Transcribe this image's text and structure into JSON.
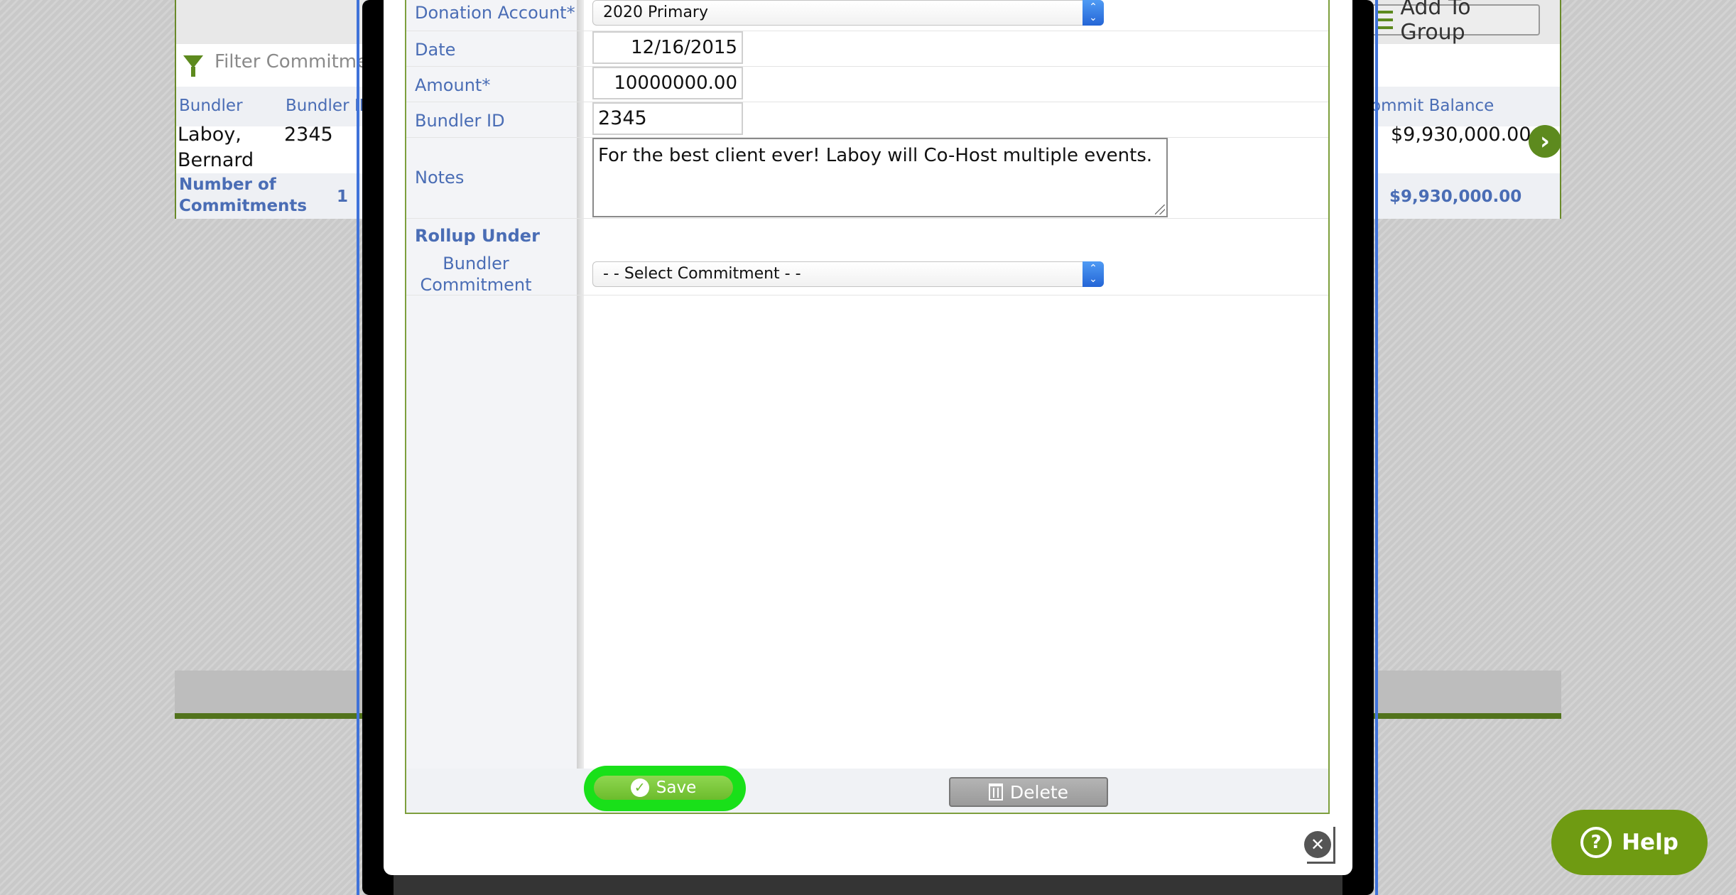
{
  "background": {
    "add_to_group_label": "Add To Group",
    "filter_placeholder": "Filter Commitme",
    "columns": [
      "Bundler",
      "Bundler ID",
      "ommit Balance"
    ],
    "row": {
      "bundler": "Laboy, Bernard",
      "bundler_id": "2345",
      "commit_balance": "$9,930,000.00"
    },
    "footer": {
      "label": "Number of Commitments",
      "count": "1",
      "total": "$9,930,000.00"
    }
  },
  "form": {
    "donation_account": {
      "label": "Donation Account*",
      "value": "2020 Primary"
    },
    "date": {
      "label": "Date",
      "value": "12/16/2015"
    },
    "amount": {
      "label": "Amount*",
      "value": "10000000.00"
    },
    "bundler_id": {
      "label": "Bundler ID",
      "value": "2345"
    },
    "notes": {
      "label": "Notes",
      "value": "For the best client ever! Laboy will Co-Host multiple events."
    },
    "rollup_under": {
      "label": "Rollup Under"
    },
    "bundler_commitment": {
      "label": "Bundler Commitment",
      "value": "- - Select Commitment - -"
    }
  },
  "buttons": {
    "save": "Save",
    "delete": "Delete",
    "help": "Help"
  },
  "colors": {
    "accent_green": "#6f9b12",
    "label_blue": "#4a6db5",
    "highlight_green": "#19e019"
  }
}
